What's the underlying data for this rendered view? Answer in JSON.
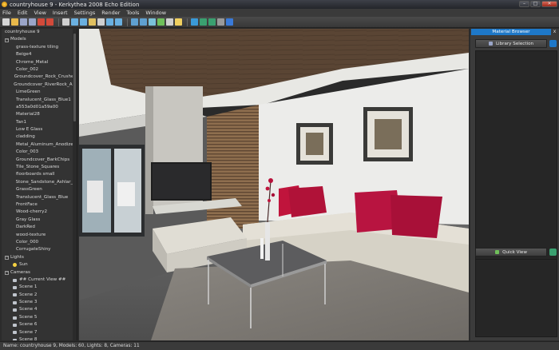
{
  "window": {
    "title": "countryhouse 9 - Kerkythea 2008 Echo Edition",
    "controls": {
      "minimize": "–",
      "maximize": "□",
      "close": "✕"
    }
  },
  "menubar": [
    "File",
    "Edit",
    "View",
    "Insert",
    "Settings",
    "Render",
    "Tools",
    "Window"
  ],
  "toolbar": {
    "icons": [
      "new-file-icon",
      "open-folder-icon",
      "save-icon",
      "save-as-icon",
      "undo-icon",
      "redo-icon",
      "select-icon",
      "move-icon",
      "rotate-icon",
      "pan-icon",
      "zoom-icon",
      "orbit-icon",
      "home-view-icon",
      "solid-view-icon",
      "wire-view-icon",
      "box-view-icon",
      "material-view-icon",
      "camera-icon",
      "light-icon",
      "globe-icon",
      "render-icon",
      "render-region-icon",
      "settings-icon",
      "help-icon"
    ],
    "colors": [
      "#d6d6d6",
      "#e8b84a",
      "#9aa5c8",
      "#9aa5c8",
      "#d24a3a",
      "#d24a3a",
      "#cfcfcf",
      "#6ab0e0",
      "#6ab0e0",
      "#e0c060",
      "#cfcfcf",
      "#6ab0e0",
      "#6ab0e0",
      "#5fa0d0",
      "#5fa0d0",
      "#7bc1d9",
      "#6fbf5a",
      "#cfcfcf",
      "#f0d060",
      "#3a9ad8",
      "#3aa070",
      "#3aa070",
      "#9a9a9a",
      "#3a7ad8"
    ]
  },
  "scene_tree": {
    "root": "countryhouse 9",
    "models_label": "Models",
    "models": [
      "grass-texture tiling",
      "Beige4",
      "Chrome_Metal",
      "Color_002",
      "Groundcover_Rock_Crushed",
      "Groundcover_RiverRock_Am",
      "LimeGreen",
      "Translucent_Glass_Blue1",
      "a553a0d01a59a00",
      "Material28",
      "Tan1",
      "Low E Glass",
      "cladding",
      "Metal_Aluminum_Anodized",
      "Color_003",
      "Groundcover_BarkChips",
      "Tile_Stone_Squares",
      "floorboards small",
      "Stone_Sandstone_Ashlar_Li",
      "GrassGreen",
      "Translucent_Glass_Blue",
      "FrontFace",
      "Wood-cherry2",
      "Gray Glass",
      "DarkRed",
      "wood-texture",
      "Color_000",
      "CorrugateShiny"
    ],
    "lights_label": "Lights",
    "lights": [
      "Sun"
    ],
    "cameras_label": "Cameras",
    "cameras": [
      "## Current View ##",
      "Scene 1",
      "Scene 2",
      "Scene 3",
      "Scene 4",
      "Scene 5",
      "Scene 6",
      "Scene 7",
      "Scene 8"
    ]
  },
  "material_browser": {
    "header": "Material Browser",
    "close": "x",
    "library_selection": "Library Selection",
    "quick_view": "Quick View"
  },
  "statusbar": {
    "text": "Name: countryhouse 9, Models: 60, Lights: 8, Cameras: 11"
  }
}
